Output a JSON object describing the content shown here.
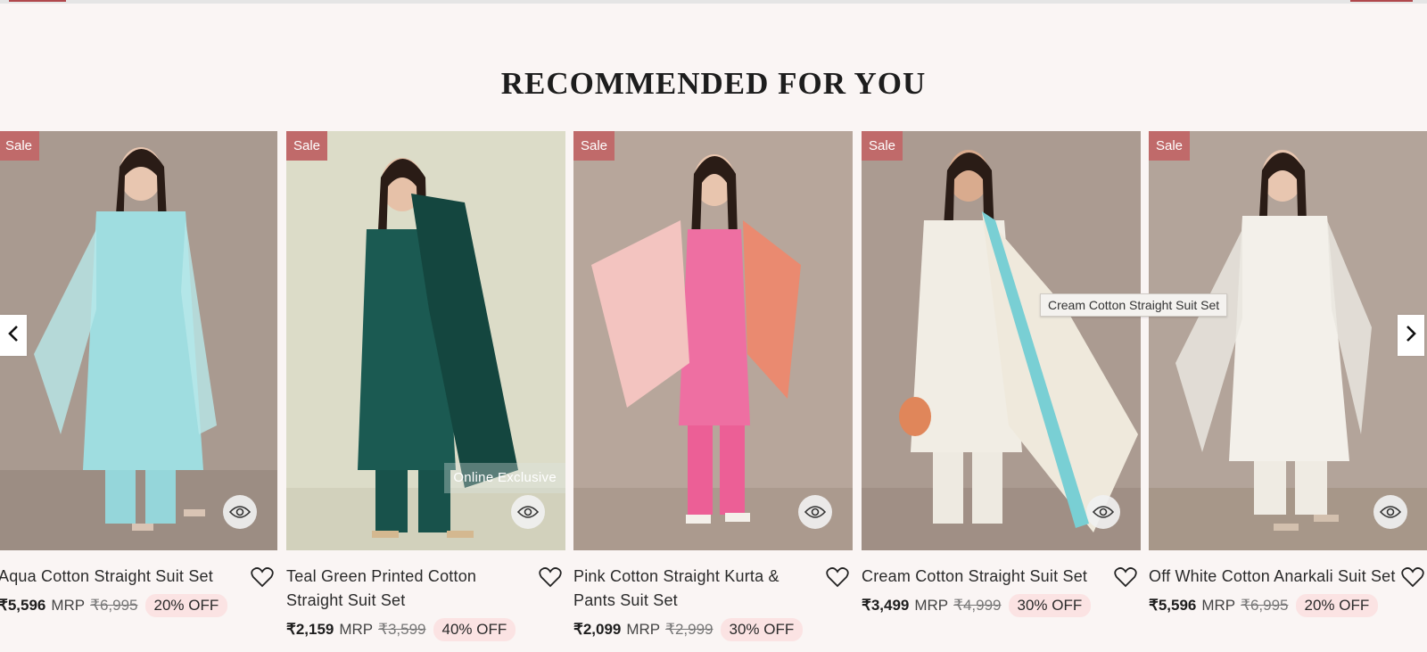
{
  "section": {
    "title": "RECOMMENDED FOR YOU"
  },
  "colors": {
    "accent": "#b0484c",
    "sale_badge": "#c06a6a",
    "off_pill": "#fbe3e3",
    "page_bg": "#faf5f4"
  },
  "carousel": {
    "prev_icon": "chevron-left-icon",
    "next_icon": "chevron-right-icon",
    "tooltip": "Cream Cotton Straight Suit Set",
    "products": [
      {
        "badge": "Sale",
        "name": "Aqua Cotton Straight Suit Set",
        "price": "₹5,596",
        "mrp_label": "MRP",
        "mrp": "₹6,995",
        "discount": "20% OFF",
        "exclusive": null
      },
      {
        "badge": "Sale",
        "name": "Teal Green Printed Cotton Straight Suit Set",
        "price": "₹2,159",
        "mrp_label": "MRP",
        "mrp": "₹3,599",
        "discount": "40% OFF",
        "exclusive": "Online Exclusive"
      },
      {
        "badge": "Sale",
        "name": "Pink Cotton Straight Kurta & Pants Suit Set",
        "price": "₹2,099",
        "mrp_label": "MRP",
        "mrp": "₹2,999",
        "discount": "30% OFF",
        "exclusive": null
      },
      {
        "badge": "Sale",
        "name": "Cream Cotton Straight Suit Set",
        "price": "₹3,499",
        "mrp_label": "MRP",
        "mrp": "₹4,999",
        "discount": "30% OFF",
        "exclusive": null
      },
      {
        "badge": "Sale",
        "name": "Off White Cotton Anarkali Suit Set",
        "price": "₹5,596",
        "mrp_label": "MRP",
        "mrp": "₹6,995",
        "discount": "20% OFF",
        "exclusive": null
      }
    ]
  }
}
